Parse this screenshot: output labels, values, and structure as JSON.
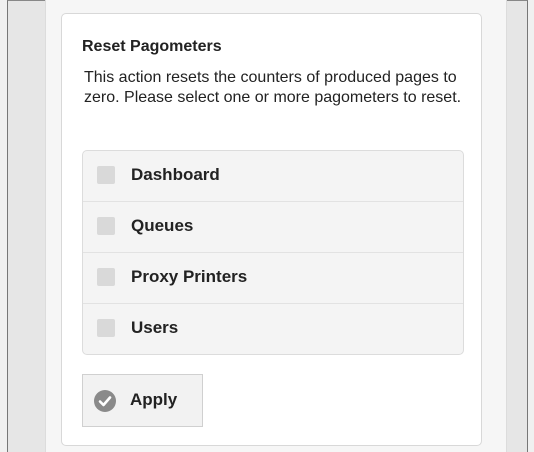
{
  "panel": {
    "title": "Reset Pagometers",
    "description": "This action resets the counters of produced pages to zero. Please select one or more pagometers to reset."
  },
  "options": [
    {
      "label": "Dashboard",
      "checked": false
    },
    {
      "label": "Queues",
      "checked": false
    },
    {
      "label": "Proxy Printers",
      "checked": false
    },
    {
      "label": "Users",
      "checked": false
    }
  ],
  "apply_button": {
    "label": "Apply",
    "icon": "check-circle-icon"
  },
  "colors": {
    "checkbox": "#d9d9d9",
    "icon": "#8a8a8a",
    "panel_border": "#d8d8d8"
  }
}
